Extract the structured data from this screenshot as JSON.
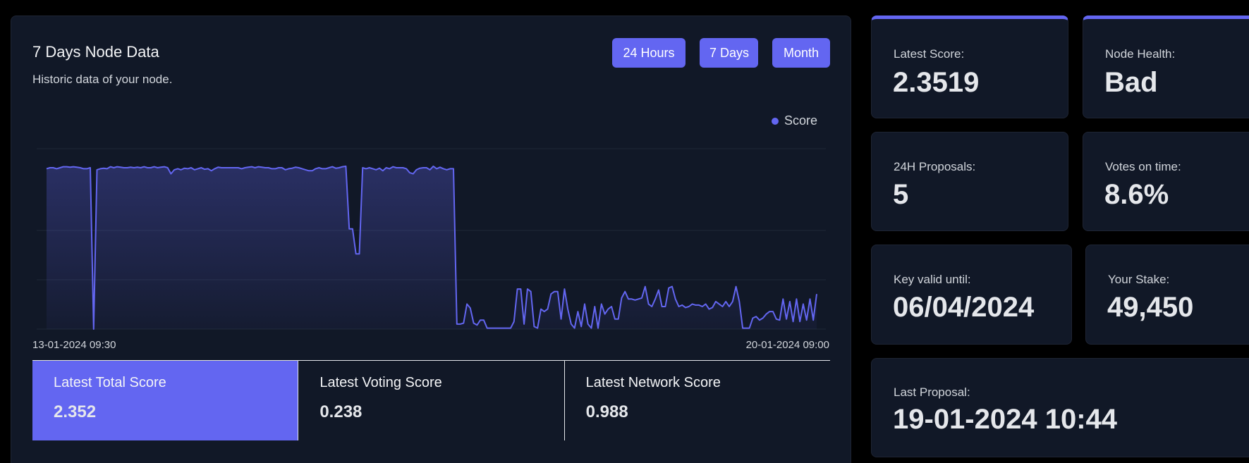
{
  "chart_card": {
    "title": "7 Days Node Data",
    "subtitle": "Historic data of your node.",
    "range_buttons": [
      "24 Hours",
      "7 Days",
      "Month"
    ],
    "legend": "Score",
    "x_start": "13-01-2024 09:30",
    "x_end": "20-01-2024 09:00"
  },
  "summary": [
    {
      "label": "Latest Total Score",
      "value": "2.352"
    },
    {
      "label": "Latest Voting Score",
      "value": "0.238"
    },
    {
      "label": "Latest Network Score",
      "value": "0.988"
    }
  ],
  "stats": {
    "latest_score": {
      "label": "Latest Score:",
      "value": "2.3519"
    },
    "node_health": {
      "label": "Node Health:",
      "value": "Bad"
    },
    "proposals": {
      "label": "24H Proposals:",
      "value": "5"
    },
    "votes": {
      "label": "Votes on time:",
      "value": "8.6%"
    },
    "key_valid": {
      "label": "Key valid until:",
      "value": "06/04/2024"
    },
    "stake": {
      "label": "Your Stake:",
      "value": "49,450"
    },
    "last_proposal": {
      "label": "Last Proposal:",
      "value": "19-01-2024 10:44"
    }
  },
  "colors": {
    "accent": "#6366f1",
    "card": "#111827",
    "background": "#000000"
  },
  "chart_data": {
    "type": "area",
    "series": [
      {
        "name": "Score",
        "values": [
          3.2,
          3.22,
          3.22,
          3.2,
          3.22,
          3.24,
          3.24,
          3.23,
          3.24,
          3.23,
          3.22,
          3.2,
          3.2,
          3.22,
          0,
          3.18,
          3.2,
          3.21,
          3.2,
          3.24,
          3.22,
          3.24,
          3.23,
          3.22,
          3.22,
          3.23,
          3.22,
          3.23,
          3.22,
          3.24,
          3.22,
          3.22,
          3.24,
          3.22,
          3.23,
          3.24,
          3.22,
          3.1,
          3.18,
          3.2,
          3.18,
          3.21,
          3.2,
          3.22,
          3.18,
          3.2,
          3.22,
          3.19,
          3.2,
          3.16,
          3.2,
          3.23,
          3.22,
          3.22,
          3.22,
          3.22,
          3.22,
          3.22,
          3.2,
          3.22,
          3.23,
          3.24,
          3.22,
          3.24,
          3.23,
          3.22,
          3.22,
          3.2,
          3.2,
          3.22,
          3.22,
          3.18,
          3.2,
          3.21,
          3.23,
          3.22,
          3.2,
          3.18,
          3.16,
          3.16,
          3.2,
          3.22,
          3.2,
          3.2,
          3.22,
          3.24,
          3.21,
          3.22,
          3.24,
          3.25,
          2.0,
          2.0,
          1.5,
          1.5,
          3.22,
          3.2,
          3.22,
          3.2,
          3.18,
          3.21,
          3.16,
          3.22,
          3.2,
          3.24,
          3.22,
          3.22,
          3.22,
          3.2,
          3.12,
          3.1,
          3.18,
          3.21,
          3.22,
          3.22,
          3.18,
          3.25,
          3.2,
          3.23,
          3.2,
          3.18,
          3.2,
          3.2,
          0.1,
          0.1,
          0.12,
          0.5,
          0.42,
          0.12,
          0.08,
          0.18,
          0.18,
          0.02,
          0.02,
          0.02,
          0.02,
          0.02,
          0.02,
          0.02,
          0.02,
          0.15,
          0.8,
          0.8,
          0.1,
          0.8,
          0.75,
          0.05,
          0.02,
          0.4,
          0.35,
          0.4,
          0.7,
          0.75,
          0.75,
          0.2,
          0.8,
          0.4,
          0.1,
          0.02,
          0.35,
          0.05,
          0.5,
          0.1,
          0.02,
          0.45,
          0.02,
          0.5,
          0.3,
          0.4,
          0.45,
          0.2,
          0.2,
          0.62,
          0.75,
          0.6,
          0.6,
          0.58,
          0.6,
          0.62,
          0.85,
          0.5,
          0.45,
          0.6,
          0.78,
          0.45,
          0.45,
          0.82,
          0.85,
          0.6,
          0.45,
          0.48,
          0.43,
          0.45,
          0.5,
          0.48,
          0.48,
          0.45,
          0.5,
          0.4,
          0.43,
          0.55,
          0.5,
          0.45,
          0.55,
          0.45,
          0.55,
          0.85,
          0.55,
          0.02,
          0.02,
          0.02,
          0.22,
          0.25,
          0.18,
          0.22,
          0.3,
          0.35,
          0.35,
          0.2,
          0.18,
          0.6,
          0.2,
          0.55,
          0.15,
          0.6,
          0.15,
          0.5,
          0.18,
          0.6,
          0.18,
          0.7
        ]
      }
    ],
    "x_start": "13-01-2024 09:30",
    "x_end": "20-01-2024 09:00",
    "ylim": [
      0,
      3.6
    ],
    "grid": true,
    "legend_position": "top-right"
  }
}
